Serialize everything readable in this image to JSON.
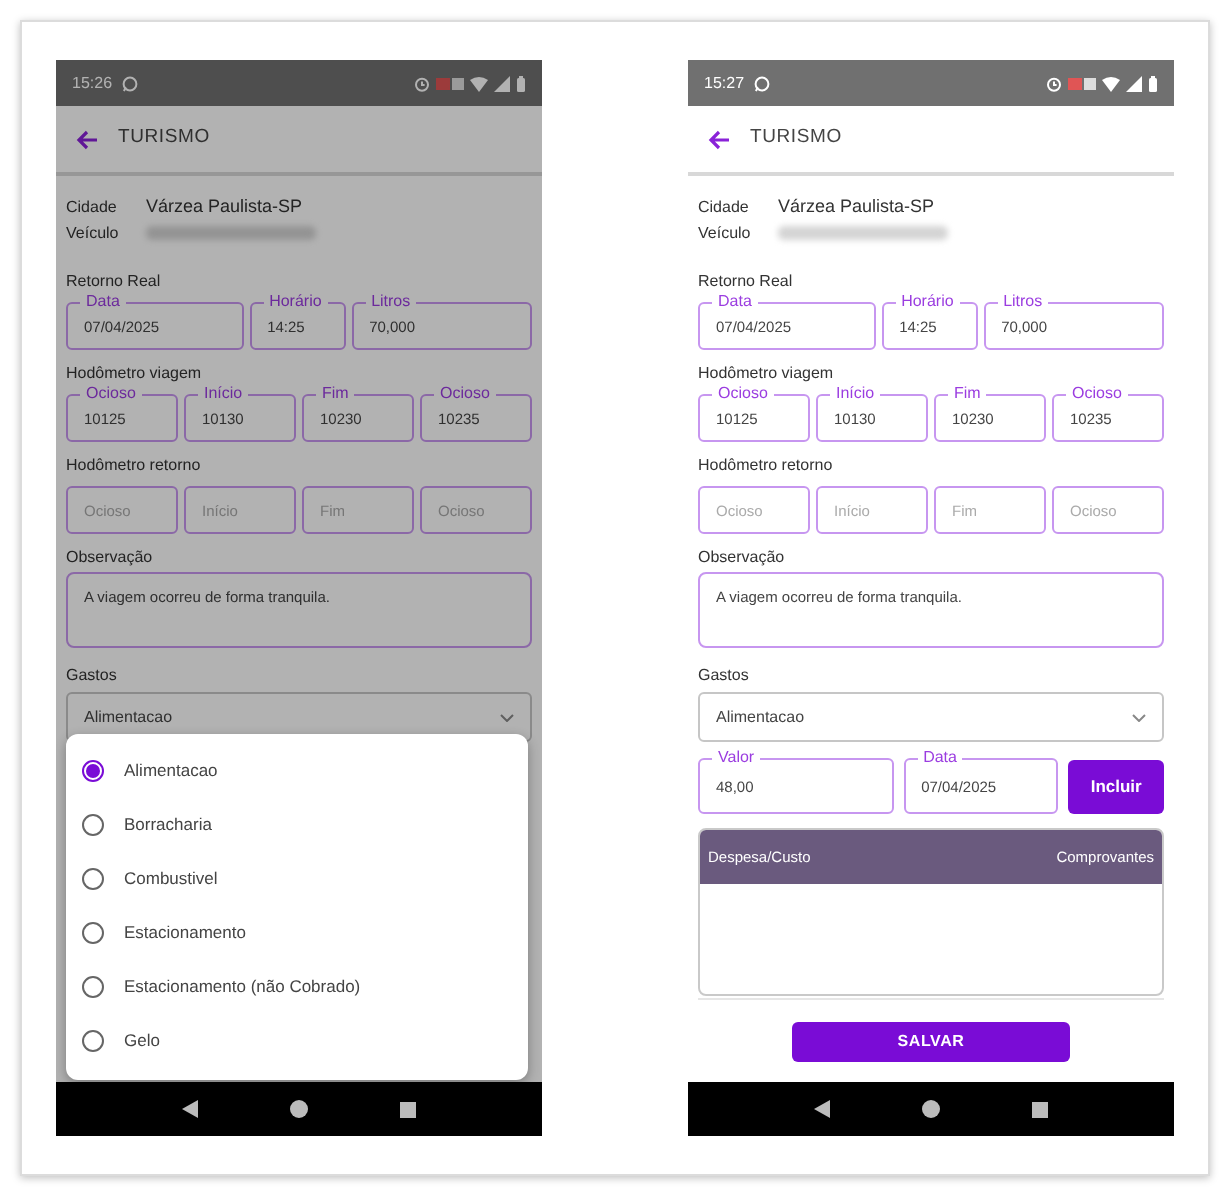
{
  "screens": [
    {
      "dimmed": true,
      "status_bar": {
        "time": "15:26"
      },
      "header": {
        "title": "TURISMO"
      },
      "info": [
        {
          "label": "Cidade",
          "value": "Várzea Paulista-SP"
        },
        {
          "label": "Veículo",
          "blurred": true
        }
      ],
      "sections": [
        {
          "title": "Retorno Real",
          "fields": [
            {
              "label": "Data",
              "value": "07/04/2025"
            },
            {
              "label": "Horário",
              "value": "14:25"
            },
            {
              "label": "Litros",
              "value": "70,000"
            }
          ]
        },
        {
          "title": "Hodômetro viagem",
          "fields": [
            {
              "label": "Ocioso",
              "value": "10125"
            },
            {
              "label": "Início",
              "value": "10130"
            },
            {
              "label": "Fim",
              "value": "10230"
            },
            {
              "label": "Ocioso",
              "value": "10235"
            }
          ]
        },
        {
          "title": "Hodômetro retorno",
          "fields": [
            {
              "placeholder": "Ocioso"
            },
            {
              "placeholder": "Início"
            },
            {
              "placeholder": "Fim"
            },
            {
              "placeholder": "Ocioso"
            }
          ]
        }
      ],
      "observacao": {
        "label": "Observação",
        "value": "A viagem ocorreu de forma tranquila."
      },
      "gastos": {
        "label": "Gastos",
        "value": "Alimentacao"
      },
      "dialog": {
        "options": [
          {
            "label": "Alimentacao",
            "selected": true
          },
          {
            "label": "Borracharia",
            "selected": false
          },
          {
            "label": "Combustivel",
            "selected": false
          },
          {
            "label": "Estacionamento",
            "selected": false
          },
          {
            "label": "Estacionamento (não Cobrado)",
            "selected": false
          },
          {
            "label": "Gelo",
            "selected": false
          }
        ]
      }
    },
    {
      "dimmed": false,
      "status_bar": {
        "time": "15:27"
      },
      "header": {
        "title": "TURISMO"
      },
      "info": [
        {
          "label": "Cidade",
          "value": "Várzea Paulista-SP"
        },
        {
          "label": "Veículo",
          "blurred": true
        }
      ],
      "sections": [
        {
          "title": "Retorno Real",
          "fields": [
            {
              "label": "Data",
              "value": "07/04/2025"
            },
            {
              "label": "Horário",
              "value": "14:25"
            },
            {
              "label": "Litros",
              "value": "70,000"
            }
          ]
        },
        {
          "title": "Hodômetro viagem",
          "fields": [
            {
              "label": "Ocioso",
              "value": "10125"
            },
            {
              "label": "Início",
              "value": "10130"
            },
            {
              "label": "Fim",
              "value": "10230"
            },
            {
              "label": "Ocioso",
              "value": "10235"
            }
          ]
        },
        {
          "title": "Hodômetro retorno",
          "fields": [
            {
              "placeholder": "Ocioso"
            },
            {
              "placeholder": "Início"
            },
            {
              "placeholder": "Fim"
            },
            {
              "placeholder": "Ocioso"
            }
          ]
        }
      ],
      "observacao": {
        "label": "Observação",
        "value": "A viagem ocorreu de forma tranquila."
      },
      "gastos": {
        "label": "Gastos",
        "value": "Alimentacao"
      },
      "entry": {
        "fields": [
          {
            "label": "Valor",
            "value": "48,00"
          },
          {
            "label": "Data",
            "value": "07/04/2025"
          }
        ],
        "button": "Incluir"
      },
      "table": {
        "columns": [
          "Despesa/Custo",
          "Comprovantes"
        ]
      },
      "save_button": "SALVAR"
    }
  ]
}
